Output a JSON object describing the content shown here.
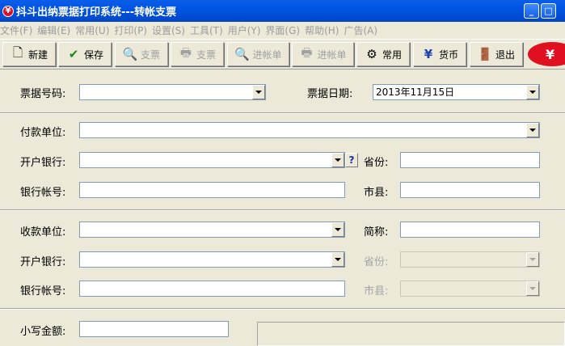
{
  "window": {
    "title": "抖斗出纳票据打印系统---转帐支票",
    "icon_char": "¥",
    "minimize_glyph": "_",
    "maximize_glyph": "□"
  },
  "menu": [
    "文件(F)",
    "编辑(E)",
    "常用(U)",
    "打印(P)",
    "设置(S)",
    "工具(T)",
    "用户(Y)",
    "界面(G)",
    "帮助(H)",
    "广告(A)"
  ],
  "toolbar": {
    "new": "新建",
    "save": "保存",
    "cheque": "支票",
    "print_cheque": "支票",
    "deposit_slip": "进帐单",
    "print_deposit_slip": "进帐单",
    "common": "常用",
    "currency": "货币",
    "exit": "退出",
    "new_glyph": "🗋",
    "save_glyph": "✔",
    "cheque_glyph": "🔍",
    "print_glyph": "🖶",
    "common_glyph": "⚙",
    "currency_glyph": "¥",
    "exit_glyph": "🚪",
    "logo_char": "¥"
  },
  "form": {
    "ticket_no_label": "票据号码:",
    "ticket_no_value": "",
    "ticket_date_label": "票据日期:",
    "ticket_date_value": "2013年11月15日",
    "payer": {
      "unit_label": "付款单位:",
      "unit_value": "",
      "bank_label": "开户银行:",
      "bank_value": "",
      "help_glyph": "?",
      "province_label": "省份:",
      "province_value": "",
      "account_label": "银行帐号:",
      "account_value": "",
      "county_label": "市县:",
      "county_value": ""
    },
    "payee": {
      "unit_label": "收款单位:",
      "unit_value": "",
      "short_label": "简称:",
      "short_value": "",
      "bank_label": "开户银行:",
      "bank_value": "",
      "province_label": "省份:",
      "province_value": "",
      "account_label": "银行帐号:",
      "account_value": "",
      "county_label": "市县:",
      "county_value": ""
    },
    "amount_label": "小写金额:",
    "amount_value": ""
  }
}
